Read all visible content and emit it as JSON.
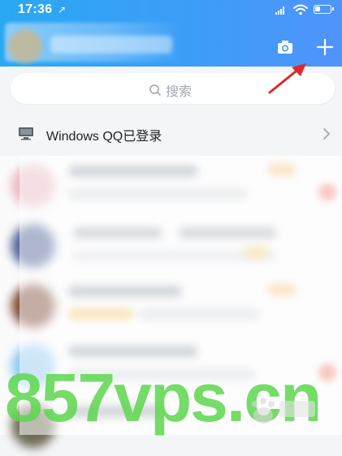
{
  "status_bar": {
    "time": "17:36",
    "location_glyph": "↗"
  },
  "header": {
    "camera": {
      "icon": "camera-icon"
    },
    "add": {
      "icon": "plus-icon"
    }
  },
  "search": {
    "placeholder": "搜索",
    "icon": "search-icon"
  },
  "login_notice": {
    "text": "Windows QQ已登录",
    "icon": "pc-icon",
    "chevron": "chevron-right-icon"
  },
  "watermark": {
    "text": "857vps.cn"
  },
  "colors": {
    "header_start": "#2aa8f2",
    "header_end": "#4f94fb",
    "arrow_red": "#e3262a",
    "watermark_green": "#5cd64c"
  }
}
